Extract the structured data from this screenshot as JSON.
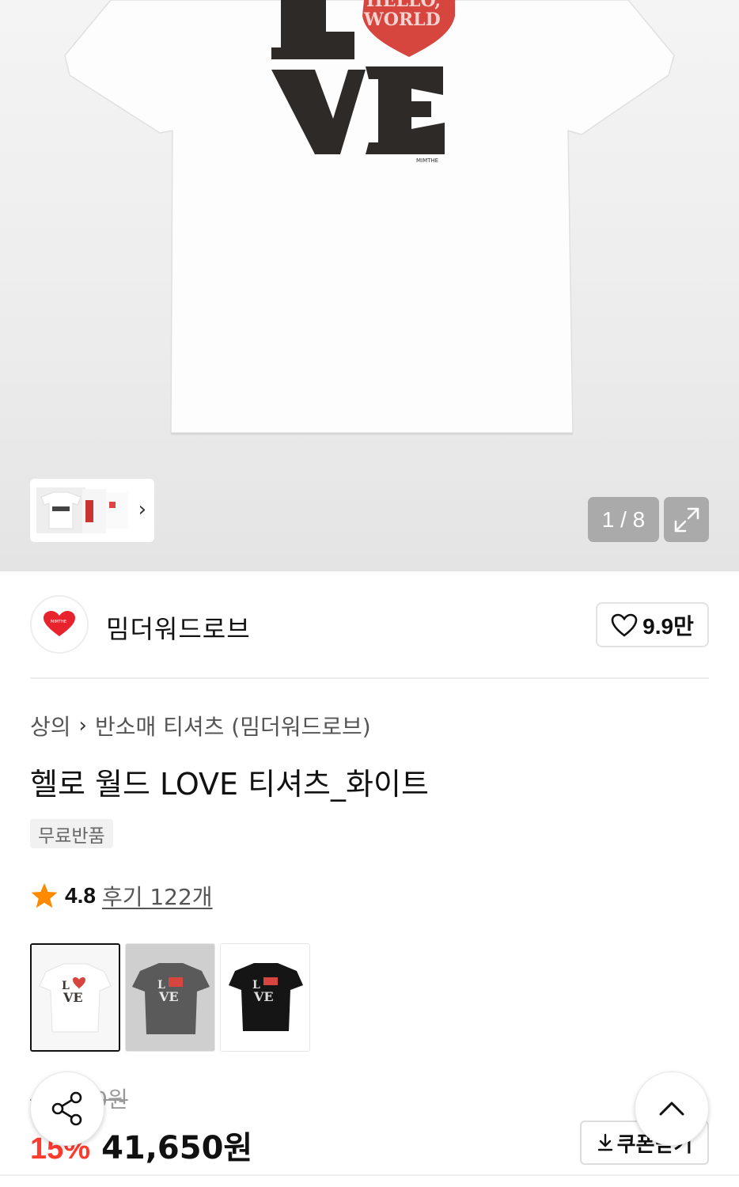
{
  "gallery": {
    "counter": "1 / 8",
    "print_line1": "HELLO,",
    "print_line2": "WORLD",
    "print_letters_top": "L",
    "print_letters_bottom": "VE",
    "print_brand": "MIMTHE"
  },
  "brand": {
    "name": "밈더워드로브",
    "logo_text": "MIMTHE",
    "likes": "9.9만"
  },
  "product": {
    "breadcrumb": [
      "상의",
      "반소매 티셔츠 (밈더워드로브)"
    ],
    "title": "헬로 월드 LOVE 티셔츠_화이트",
    "badge": "무료반품",
    "rating": "4.8",
    "reviews": "후기 122개",
    "colors": [
      "#ffffff",
      "#5a5a5a",
      "#111111"
    ]
  },
  "price": {
    "original": "49,000원",
    "discount": "15%",
    "sale": "41,650원",
    "coupon_label": "쿠폰받기"
  },
  "icons": {
    "share": "share-icon",
    "top": "chevron-up-icon",
    "expand": "expand-icon",
    "like": "heart-icon",
    "rating": "star-icon",
    "coupon": "download-icon"
  },
  "colors": {
    "accent": "#ff3b30",
    "star": "#ff8a00",
    "heart": "#e8232e"
  }
}
